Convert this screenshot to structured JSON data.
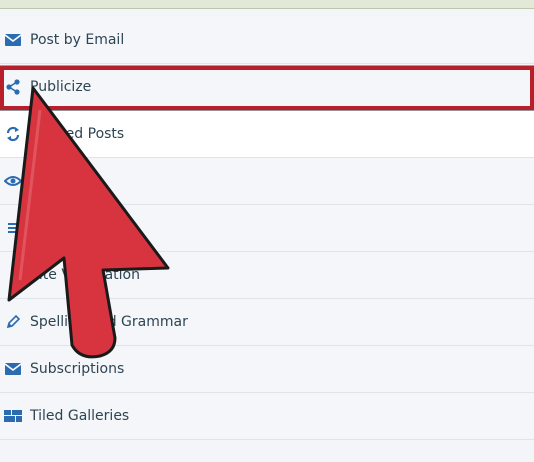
{
  "settings_list": {
    "items": [
      {
        "label": "Post by Email",
        "icon": "envelope-icon"
      },
      {
        "label": "Publicize",
        "icon": "share-icon"
      },
      {
        "label": "Related Posts",
        "icon": "refresh-icon"
      },
      {
        "label": "",
        "icon": "eye-icon"
      },
      {
        "label": "",
        "icon": "blank"
      },
      {
        "label": "Site Verification",
        "icon": "blank"
      },
      {
        "label": "Spelling and Grammar",
        "icon": "pencil-icon"
      },
      {
        "label": "Subscriptions",
        "icon": "envelope-icon"
      },
      {
        "label": "Tiled Galleries",
        "icon": "grid-icon"
      }
    ]
  },
  "colors": {
    "icon": "#2b6cb0",
    "text": "#2e4453",
    "highlight": "#b71f2b",
    "arrow": "#d73440"
  },
  "annotation": {
    "type": "pointer-arrow",
    "target": "Publicize"
  }
}
